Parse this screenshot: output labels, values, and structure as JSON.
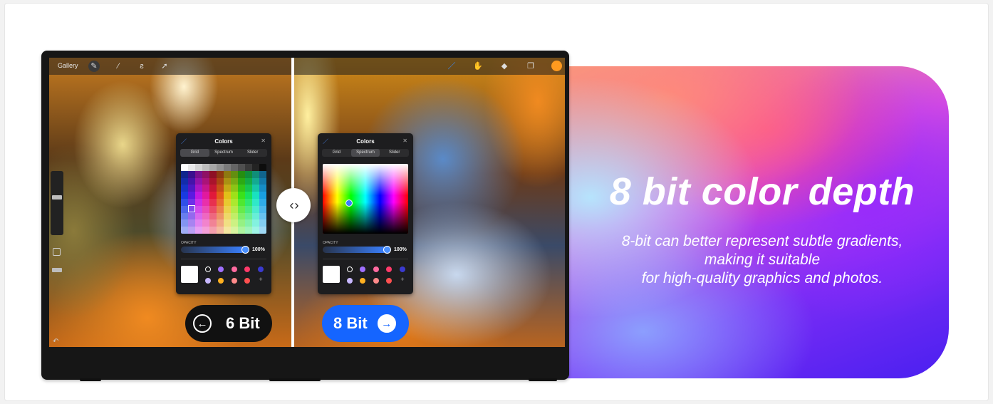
{
  "headline": "8 bit color depth",
  "description_lines": [
    "8-bit can better represent subtle gradients,",
    "making it suitable",
    " for high-quality graphics and photos."
  ],
  "app_toolbar": {
    "gallery_label": "Gallery",
    "left_icons": [
      "wrench-icon",
      "magic-wand-icon",
      "selection-icon",
      "move-arrow-icon"
    ],
    "right_icons": [
      "brush-icon",
      "smudge-icon",
      "eraser-icon",
      "layers-icon"
    ],
    "current_color": "#ff9a1f"
  },
  "colors_panel_left": {
    "title": "Colors",
    "tabs": [
      "Grid",
      "Spectrum",
      "Slider"
    ],
    "active_tab": "Grid",
    "opacity_label": "OPACITY",
    "opacity_value": "100%"
  },
  "colors_panel_right": {
    "title": "Colors",
    "tabs": [
      "Grid",
      "Spectrum",
      "Slider"
    ],
    "active_tab": "Spectrum",
    "opacity_label": "OPACITY",
    "opacity_value": "100%"
  },
  "swatches": [
    "#a070ff",
    "#ff6aa0",
    "#ff3a6a",
    "#3a3ad0",
    "#c8b8ff",
    "#ffb020",
    "#ff8a8a",
    "#ff5050",
    "#ff4a4a"
  ],
  "pill_6bit": {
    "label": "6 Bit",
    "icon": "arrow-left-icon"
  },
  "pill_8bit": {
    "label": "8 Bit",
    "icon": "arrow-right-icon"
  },
  "compare_handle_icon": "chevron-left-right-icon",
  "colors": {
    "pill_8bit_bg": "#1565ff",
    "pill_6bit_bg": "#111111"
  }
}
